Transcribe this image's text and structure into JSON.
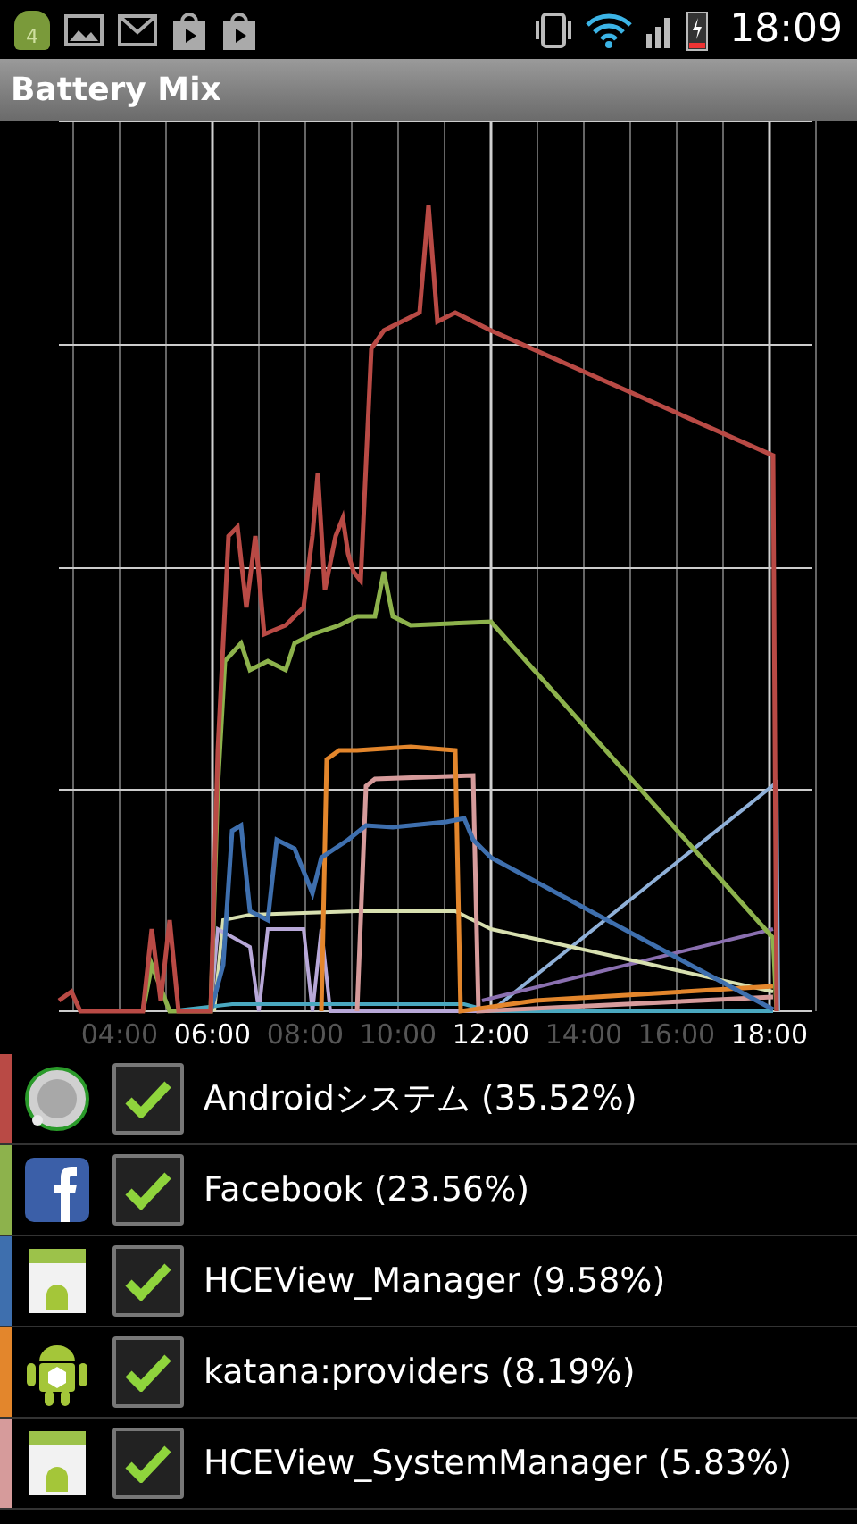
{
  "status_bar": {
    "notification_badge": "4",
    "time": "18:09"
  },
  "title_bar": {
    "title": "Battery Mix"
  },
  "chart": {
    "x_labels": [
      {
        "label": "04:00",
        "emphasized": false
      },
      {
        "label": "06:00",
        "emphasized": true
      },
      {
        "label": "08:00",
        "emphasized": false
      },
      {
        "label": "10:00",
        "emphasized": false
      },
      {
        "label": "12:00",
        "emphasized": true
      },
      {
        "label": "14:00",
        "emphasized": false
      },
      {
        "label": "16:00",
        "emphasized": false
      },
      {
        "label": "18:00",
        "emphasized": true
      }
    ]
  },
  "apps": [
    {
      "kind": "disc",
      "name": "Androidシステム (35.52%)",
      "checked": true,
      "color": "#b94a45"
    },
    {
      "kind": "facebook",
      "name": "Facebook (23.56%)",
      "checked": true,
      "color": "#8db24c"
    },
    {
      "kind": "package",
      "name": "HCEView_Manager (9.58%)",
      "checked": true,
      "color": "#3e6fae"
    },
    {
      "kind": "robot",
      "name": "katana:providers (8.19%)",
      "checked": true,
      "color": "#e3862c"
    },
    {
      "kind": "package",
      "name": "HCEView_SystemManager (5.83%)",
      "checked": true,
      "color": "#d69b9b"
    }
  ]
}
